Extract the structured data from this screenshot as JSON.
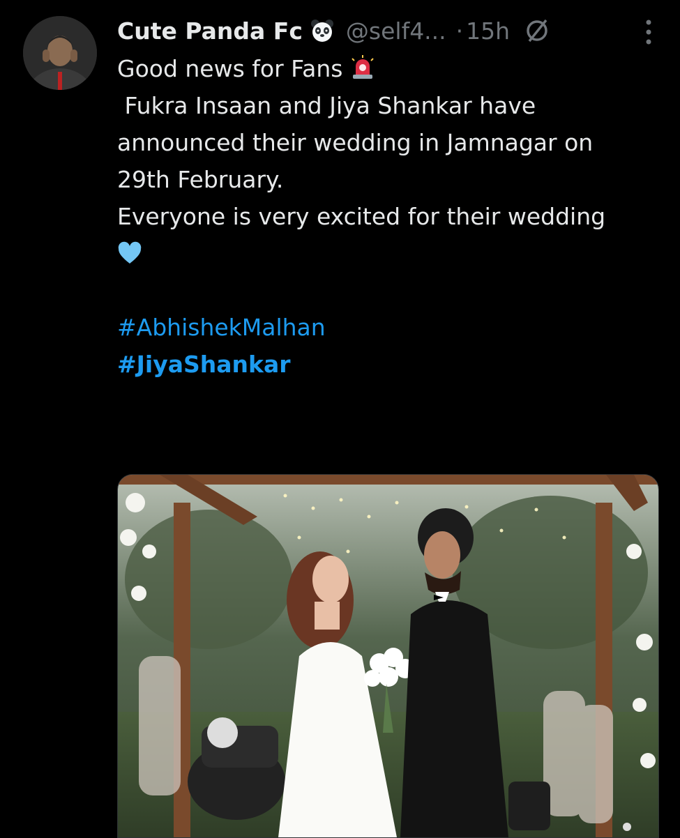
{
  "tweet": {
    "display_name": "Cute Panda Fc",
    "handle": "@self4...",
    "separator": "·",
    "time": "15h",
    "lines": [
      {
        "text": "Good news for Fans"
      },
      {
        "text": ""
      },
      {
        "text": " Fukra Insaan and Jiya Shankar have"
      },
      {
        "text": "announced their wedding in Jamnagar on"
      },
      {
        "text": "29th February."
      },
      {
        "text": ""
      },
      {
        "text": "Everyone is very excited for their wedding"
      }
    ],
    "hashtags": [
      "#AbhishekMalhan",
      "#JiyaShankar"
    ],
    "icons": [
      "panda-emoji-icon",
      "siren-emoji-icon",
      "light-blue-heart-emoji-icon",
      "grok-icon",
      "more-vertical-icon"
    ]
  },
  "colors": {
    "background": "#000000",
    "text": "#e7e9ea",
    "muted": "#71767b",
    "link": "#1d9bf0"
  }
}
